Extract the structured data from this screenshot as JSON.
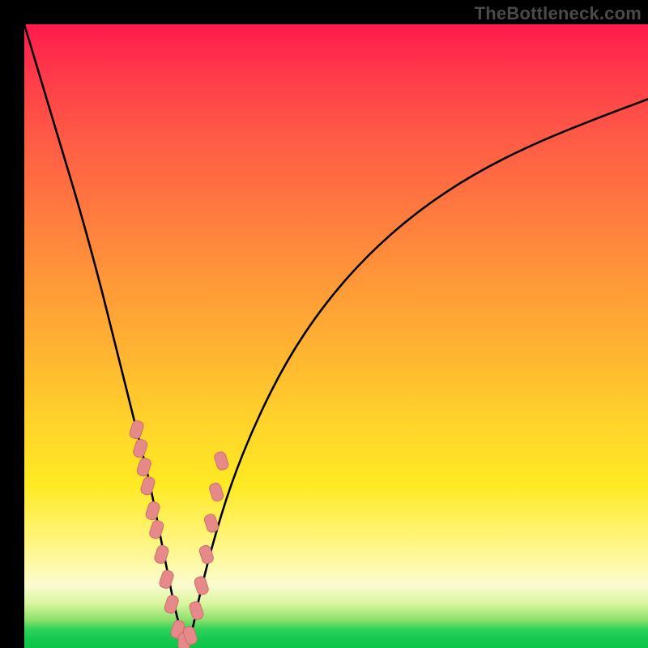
{
  "watermark": "TheBottleneck.com",
  "colors": {
    "frame": "#000000",
    "curve": "#000000",
    "marker_fill": "#e58a88",
    "marker_stroke": "#cf6e6c"
  },
  "chart_data": {
    "type": "line",
    "title": "",
    "xlabel": "",
    "ylabel": "",
    "xlim": [
      0,
      100
    ],
    "ylim": [
      0,
      100
    ],
    "grid": false,
    "legend": false,
    "annotations": [
      "TheBottleneck.com"
    ],
    "series": [
      {
        "name": "bottleneck-curve",
        "x": [
          0,
          3,
          6,
          9,
          12,
          14,
          16,
          18,
          20,
          21,
          22,
          23,
          24,
          25,
          26,
          27,
          28,
          30,
          33,
          37,
          42,
          48,
          55,
          63,
          72,
          82,
          92,
          100
        ],
        "y": [
          100,
          90,
          80,
          70,
          59,
          51,
          43,
          35,
          27,
          22,
          17,
          12,
          7,
          3,
          0,
          3,
          8,
          16,
          26,
          36,
          46,
          55,
          63,
          70,
          76,
          81,
          85,
          88
        ]
      }
    ],
    "markers": {
      "name": "highlighted-points",
      "shape": "rounded-rect",
      "x": [
        18.0,
        18.6,
        19.2,
        19.8,
        20.6,
        21.2,
        22.0,
        22.8,
        23.6,
        24.6,
        25.6,
        26.6,
        27.6,
        28.4,
        29.2,
        30.0,
        30.8,
        31.6
      ],
      "y": [
        35,
        32,
        29,
        26,
        22,
        19,
        15,
        11,
        7,
        3,
        1,
        2,
        6,
        10,
        15,
        20,
        25,
        30
      ]
    }
  }
}
